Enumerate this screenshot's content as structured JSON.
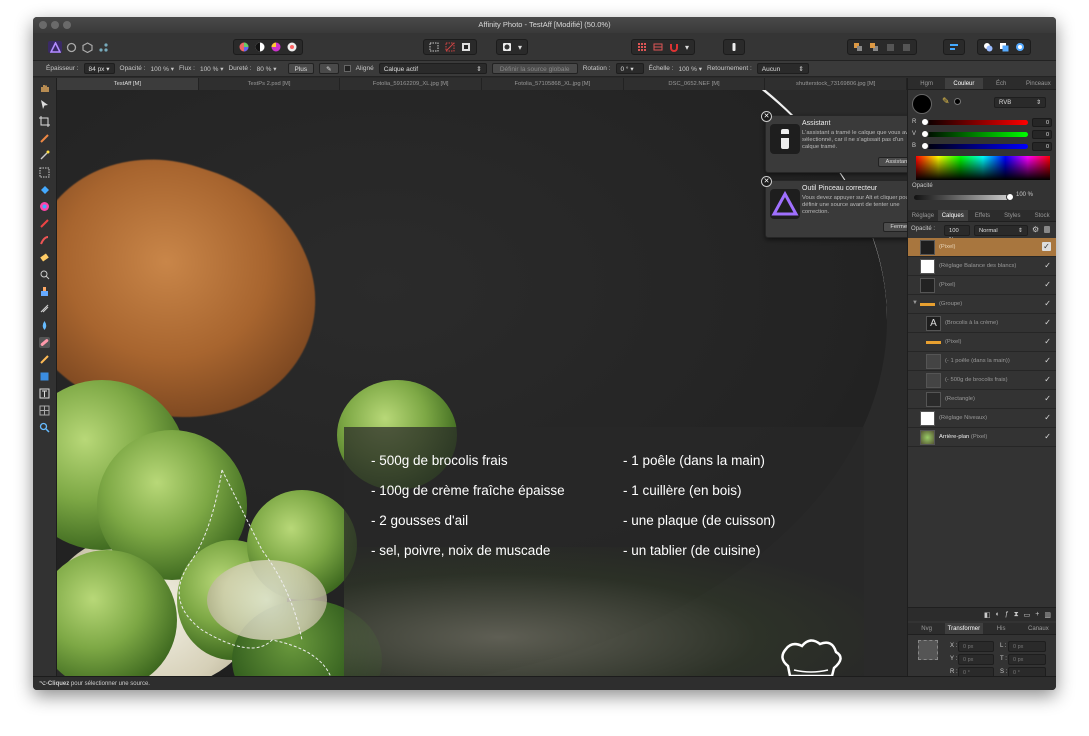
{
  "window": {
    "title": "Affinity Photo - TestAff [Modifié] (50.0%)"
  },
  "context_toolbar": {
    "width_label": "Épaisseur :",
    "width_value": "84 px",
    "opacity_label": "Opacité :",
    "opacity_value": "100 %",
    "flow_label": "Flux :",
    "flow_value": "100 %",
    "hardness_label": "Dureté :",
    "hardness_value": "80 %",
    "more_label": "Plus",
    "aligned_label": "Aligné",
    "source_value": "Calque actif",
    "global_source_label": "Définir la source globale",
    "rotation_label": "Rotation :",
    "rotation_value": "0 °",
    "scale_label": "Échelle :",
    "scale_value": "100 %",
    "flip_label": "Retournement :",
    "flip_value": "Aucun"
  },
  "doc_tabs": [
    "TestAff [M]",
    "TestPs 2.psd [M]",
    "Fotolia_59162209_XL.jpg [M]",
    "Fotolia_57105868_XL.jpg [M]",
    "DSC_0652.NEF [M]",
    "shutterstock_73169806.jpg [M]"
  ],
  "canvas": {
    "ingredients_left": [
      "- 500g de brocolis frais",
      "- 100g de crème fraîche épaisse",
      "- 2 gousses d'ail",
      "- sel, poivre, noix de muscade"
    ],
    "ingredients_right": [
      "- 1 poêle (dans la main)",
      "- 1 cuillère (en bois)",
      "- une plaque (de cuisson)",
      "- un tablier (de cuisine)"
    ]
  },
  "notifications": [
    {
      "title": "Assistant",
      "body": "L'assistant a tramé le calque que vous aviez sélectionné, car il ne s'agissait pas d'un calque tramé.",
      "button": "Assistant"
    },
    {
      "title": "Outil Pinceau correcteur",
      "body": "Vous devez appuyer sur Alt et cliquer pour définir une source avant de tenter une correction.",
      "button": "Fermer"
    }
  ],
  "color_panel": {
    "tabs": [
      "Hgm",
      "Couleur",
      "Éch",
      "Pinceaux"
    ],
    "active_tab": "Couleur",
    "model": "RVB",
    "channels": [
      {
        "label": "R",
        "value": "0"
      },
      {
        "label": "V",
        "value": "0"
      },
      {
        "label": "B",
        "value": "0"
      }
    ],
    "opacity_label": "Opacité",
    "opacity_value": "100 %"
  },
  "layers_panel": {
    "tabs": [
      "Réglage",
      "Calques",
      "Effets",
      "Styles",
      "Stock"
    ],
    "active_tab": "Calques",
    "opacity_label": "Opacité :",
    "opacity_value": "100 %",
    "blend_mode": "Normal",
    "layers": [
      {
        "name": "(Pixel)",
        "selected": true
      },
      {
        "name": "(Réglage Balance des blancs)"
      },
      {
        "name": "(Pixel)"
      },
      {
        "name": "(Groupe)"
      },
      {
        "name": "(Brocolis à la crème)"
      },
      {
        "name": "(Pixel)"
      },
      {
        "name": "(- 1 poêle (dans la main))"
      },
      {
        "name": "(- 500g de brocolis frais)"
      },
      {
        "name": "(Rectangle)"
      },
      {
        "name": "(Réglage Niveaux)"
      },
      {
        "name": "Arrière-plan",
        "suffix": "(Pixel)"
      }
    ]
  },
  "transform_panel": {
    "tabs": [
      "Nvg",
      "Transformer",
      "His",
      "Canaux"
    ],
    "active_tab": "Transformer",
    "fields": [
      {
        "label": "X :",
        "value": "0 px"
      },
      {
        "label": "L :",
        "value": "0 px"
      },
      {
        "label": "Y :",
        "value": "0 px"
      },
      {
        "label": "T :",
        "value": "0 px"
      },
      {
        "label": "R :",
        "value": "0 °"
      },
      {
        "label": "S :",
        "value": "0 °"
      }
    ]
  },
  "status": {
    "key": "⌥-Cliquez",
    "text": "pour sélectionner une source."
  }
}
